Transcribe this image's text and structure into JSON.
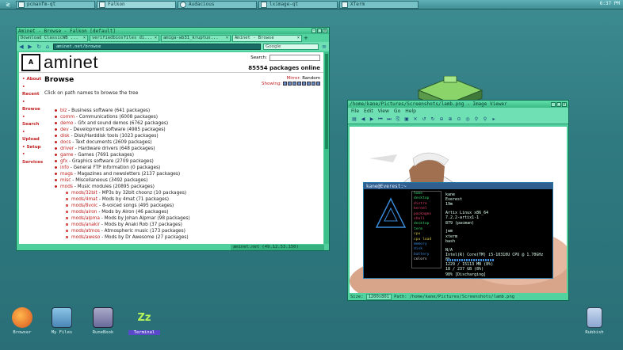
{
  "taskbar": {
    "start_glyph": "≷",
    "tasks": [
      {
        "label": "pcmanfm-qt",
        "active": false
      },
      {
        "label": "Falkon",
        "active": true
      },
      {
        "label": "Audacious",
        "active": false
      },
      {
        "label": "lximage-qt",
        "active": false
      },
      {
        "label": "XTerm",
        "active": false
      }
    ],
    "clock": "6:37 PM"
  },
  "browser": {
    "title": "Aminet - Browse - Falkon [default]",
    "tabs": [
      {
        "label": "Download ClassicWB ...",
        "current": false
      },
      {
        "label": "verifiedbiosfiles di...",
        "current": false
      },
      {
        "label": "amiga-wb31_kruptux...",
        "current": false
      },
      {
        "label": "Aminet - Browse",
        "current": true
      }
    ],
    "url": "aminet.net/browse",
    "search_placeholder": "Google",
    "status": "aminet.net (49.12.53.150)",
    "page": {
      "brand": "aminet",
      "search_label": "Search:",
      "pkg_count": "85554 packages online",
      "sidebar": [
        "About",
        "Recent",
        "Browse",
        "Search",
        "Upload",
        "Setup",
        "Services"
      ],
      "heading": "Browse",
      "mirror_label": "Mirror:",
      "mirror_value": "Random",
      "showing_label": "Showing:",
      "intro": "Click on path names to browse the tree",
      "categories": [
        {
          "name": "biz",
          "desc": " - Business software (641 packages)",
          "sub": false
        },
        {
          "name": "comm",
          "desc": " - Communications (6008 packages)",
          "sub": false
        },
        {
          "name": "demo",
          "desc": " - Gfx and sound demos (6762 packages)",
          "sub": false
        },
        {
          "name": "dev",
          "desc": " - Development software (4985 packages)",
          "sub": false
        },
        {
          "name": "disk",
          "desc": " - Disk/Harddisk tools (1023 packages)",
          "sub": false
        },
        {
          "name": "docs",
          "desc": " - Text documents (2609 packages)",
          "sub": false
        },
        {
          "name": "driver",
          "desc": " - Hardware drivers (648 packages)",
          "sub": false
        },
        {
          "name": "game",
          "desc": " - Games (7691 packages)",
          "sub": false
        },
        {
          "name": "gfx",
          "desc": " - Graphics software (2709 packages)",
          "sub": false
        },
        {
          "name": "info",
          "desc": " - General FTP information (0 packages)",
          "sub": false
        },
        {
          "name": "mags",
          "desc": " - Magazines and newsletters (2137 packages)",
          "sub": false
        },
        {
          "name": "misc",
          "desc": " - Miscellaneous (3492 packages)",
          "sub": false
        },
        {
          "name": "mods",
          "desc": " - Music modules (20895 packages)",
          "sub": false
        },
        {
          "name": "mods/32bit",
          "desc": " - MP3s by 32bit choonz (10 packages)",
          "sub": true
        },
        {
          "name": "mods/4mat",
          "desc": " - Mods by 4mat (71 packages)",
          "sub": true
        },
        {
          "name": "mods/8voic",
          "desc": " - 8-voiced songs (495 packages)",
          "sub": true
        },
        {
          "name": "mods/airon",
          "desc": " - Mods by Airon (46 packages)",
          "sub": true
        },
        {
          "name": "mods/alpma",
          "desc": " - Mods by Johan Alpmar (98 packages)",
          "sub": true
        },
        {
          "name": "mods/anakir",
          "desc": " - Mods by Anaki Rob (37 packages)",
          "sub": true
        },
        {
          "name": "mods/atmos",
          "desc": " - Atmospheric music (173 packages)",
          "sub": true
        },
        {
          "name": "mods/aweso",
          "desc": " - Mods by Dr Awesome (27 packages)",
          "sub": true
        }
      ]
    }
  },
  "viewer": {
    "title": "/home/kane/Pictures/Screenshots/lamb.png - Image Viewer",
    "menu": [
      "File",
      "Edit",
      "View",
      "Go",
      "Help"
    ],
    "status_size_label": "Size:",
    "status_size": "1200x801",
    "status_path_label": "Path:",
    "status_path": "/home/kane/Pictures/Screenshots/lamb.png"
  },
  "terminal": {
    "title": "kane@Everest:~",
    "menu_items": [
      "home",
      "desktop",
      "distro",
      "kernel",
      "packages",
      "shell",
      "desktop",
      "term",
      "cpu",
      "cpu load",
      "memory",
      "disk",
      "battery",
      "colors"
    ],
    "values": [
      "kane",
      "Everest",
      "19m",
      "",
      "Artix Linux x86_64",
      "7.2.2-artix1-1",
      "879 (pacman)",
      "",
      "jwm",
      "xterm",
      "bash",
      "",
      "N/A",
      "Intel(R) Core(TM) i5-10310U CPU @ 1.70GHz",
      "8%",
      "1229 / 15113 MB (8%)",
      "18 / 237 GB (8%)",
      "98% [Discharging]"
    ]
  },
  "desktop": {
    "icons": [
      {
        "label": "Browser",
        "selected": false
      },
      {
        "label": "My Files",
        "selected": false
      },
      {
        "label": "RuneBook",
        "selected": false
      },
      {
        "label": "Terminal",
        "selected": true
      },
      {
        "label": "Rubbish",
        "selected": false
      }
    ]
  },
  "colors": {
    "desktop": "#2f7a80",
    "window": "#4fcf9b",
    "link": "#c02020"
  }
}
